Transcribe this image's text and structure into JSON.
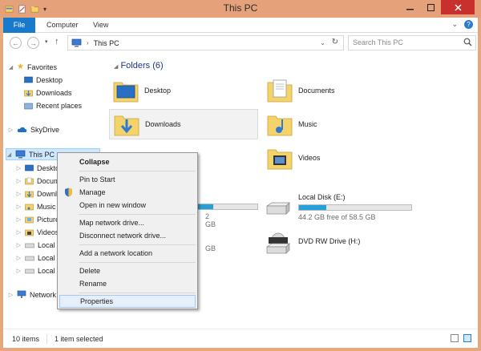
{
  "window": {
    "title": "This PC",
    "colors": {
      "frame": "#e5a27a",
      "accent": "#1979ca",
      "close": "#c7302c",
      "selection": "#cde8ff"
    }
  },
  "ribbon": {
    "tabs": [
      "File",
      "Computer",
      "View"
    ]
  },
  "address": {
    "path": "This PC",
    "search_placeholder": "Search This PC"
  },
  "nav": {
    "favorites_label": "Favorites",
    "favorites": [
      "Desktop",
      "Downloads",
      "Recent places"
    ],
    "skydrive": "SkyDrive",
    "thispc": "This PC",
    "thispc_children": [
      "Desktop",
      "Documents",
      "Downloads",
      "Music",
      "Pictures",
      "Videos",
      "Local Disk (C:)",
      "Local Disk (D:)",
      "Local Disk (E:)"
    ],
    "network": "Network"
  },
  "main": {
    "folders_header": "Folders (6)",
    "folders": [
      "Desktop",
      "Documents",
      "Downloads",
      "Music",
      "Videos"
    ],
    "drives": [
      {
        "name": "Local Disk (E:)",
        "free": "44.2 GB free of 58.5 GB",
        "used_fraction": 0.24
      },
      {
        "name": "DVD RW Drive (H:)"
      }
    ],
    "left_drive_fragments": [
      "2 GB",
      "GB"
    ],
    "left_drive_fraction": 0.25
  },
  "context_menu": {
    "items": [
      "Collapse",
      "Pin to Start",
      "Manage",
      "Open in new window",
      "Map network drive...",
      "Disconnect network drive...",
      "Add a network location",
      "Delete",
      "Rename",
      "Properties"
    ]
  },
  "status": {
    "items_count": "10 items",
    "selected": "1 item selected"
  }
}
